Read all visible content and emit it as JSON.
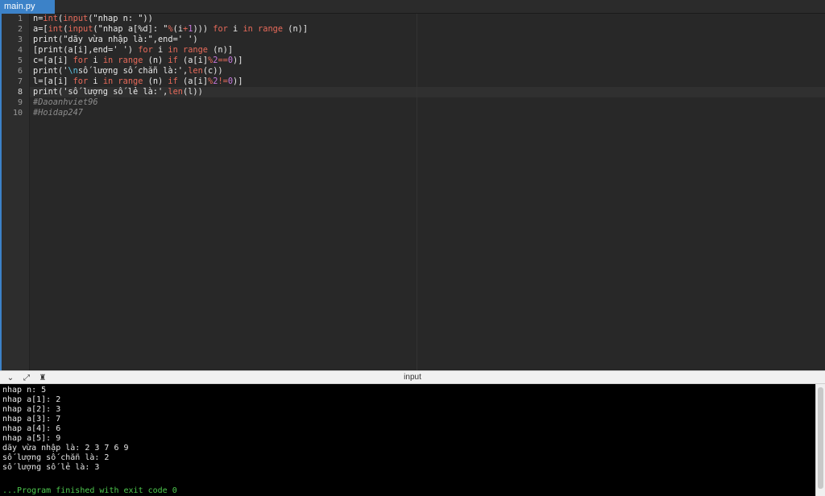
{
  "tab": {
    "filename": "main.py"
  },
  "editor": {
    "active_line": 8,
    "lines": [
      {
        "n": "1",
        "segs": [
          [
            "plain",
            "n="
          ],
          [
            "fn",
            "int"
          ],
          [
            "plain",
            "("
          ],
          [
            "fn",
            "input"
          ],
          [
            "plain",
            "(\"nhap n: \"))"
          ]
        ]
      },
      {
        "n": "2",
        "segs": [
          [
            "plain",
            "a=["
          ],
          [
            "fn",
            "int"
          ],
          [
            "plain",
            "("
          ],
          [
            "fn",
            "input"
          ],
          [
            "plain",
            "(\"nhap a[%d]: \""
          ],
          [
            "op",
            "%"
          ],
          [
            "plain",
            "(i"
          ],
          [
            "op",
            "+"
          ],
          [
            "num",
            "1"
          ],
          [
            "plain",
            ")))"
          ],
          [
            "kw",
            " for "
          ],
          [
            "plain",
            "i "
          ],
          [
            "kw",
            "in"
          ],
          [
            "fn",
            " range"
          ],
          [
            "plain",
            " (n)]"
          ]
        ]
      },
      {
        "n": "3",
        "segs": [
          [
            "plain",
            "print(\"dãy vừa nhập là:\",end=' ')"
          ]
        ]
      },
      {
        "n": "4",
        "segs": [
          [
            "plain",
            "[print(a[i],end=' ')"
          ],
          [
            "kw",
            " for "
          ],
          [
            "plain",
            "i "
          ],
          [
            "kw",
            "in"
          ],
          [
            "fn",
            " range"
          ],
          [
            "plain",
            " (n)]"
          ]
        ]
      },
      {
        "n": "5",
        "segs": [
          [
            "plain",
            "c=[a[i]"
          ],
          [
            "kw",
            " for "
          ],
          [
            "plain",
            "i "
          ],
          [
            "kw",
            "in"
          ],
          [
            "fn",
            " range"
          ],
          [
            "plain",
            " (n) "
          ],
          [
            "kw",
            "if"
          ],
          [
            "plain",
            " (a[i]"
          ],
          [
            "op",
            "%"
          ],
          [
            "num",
            "2"
          ],
          [
            "op",
            "=="
          ],
          [
            "num",
            "0"
          ],
          [
            "plain",
            ")]"
          ]
        ]
      },
      {
        "n": "6",
        "segs": [
          [
            "plain",
            "print('"
          ],
          [
            "esc",
            "\\n"
          ],
          [
            "plain",
            "số lượng số chẵn là:',"
          ],
          [
            "fn",
            "len"
          ],
          [
            "plain",
            "(c))"
          ]
        ]
      },
      {
        "n": "7",
        "segs": [
          [
            "plain",
            "l=[a[i]"
          ],
          [
            "kw",
            " for "
          ],
          [
            "plain",
            "i "
          ],
          [
            "kw",
            "in"
          ],
          [
            "fn",
            " range"
          ],
          [
            "plain",
            " (n) "
          ],
          [
            "kw",
            "if"
          ],
          [
            "plain",
            " (a[i]"
          ],
          [
            "op",
            "%"
          ],
          [
            "num",
            "2"
          ],
          [
            "op",
            "!="
          ],
          [
            "num",
            "0"
          ],
          [
            "plain",
            ")]"
          ]
        ]
      },
      {
        "n": "8",
        "segs": [
          [
            "plain",
            "print('số lượng số lẻ là:',"
          ],
          [
            "fn",
            "len"
          ],
          [
            "plain",
            "(l))"
          ]
        ]
      },
      {
        "n": "9",
        "segs": [
          [
            "cmt",
            "#Daoanhviet96"
          ]
        ]
      },
      {
        "n": "10",
        "segs": [
          [
            "cmt",
            "#Hoidap247"
          ]
        ]
      }
    ]
  },
  "panel": {
    "title": "input",
    "buttons": [
      {
        "name": "collapse-icon",
        "glyph": "⌄"
      },
      {
        "name": "expand-icon",
        "glyph": "⤢"
      },
      {
        "name": "clear-console-icon",
        "glyph": "♜"
      }
    ]
  },
  "console": {
    "lines": [
      "nhap n: 5",
      "nhap a[1]: 2",
      "nhap a[2]: 3",
      "nhap a[3]: 7",
      "nhap a[4]: 6",
      "nhap a[5]: 9",
      "dãy vừa nhập là: 2 3 7 6 9",
      "số lượng số chẵn là: 2",
      "số lượng số lẻ là: 3"
    ],
    "finished": "...Program finished with exit code 0"
  }
}
